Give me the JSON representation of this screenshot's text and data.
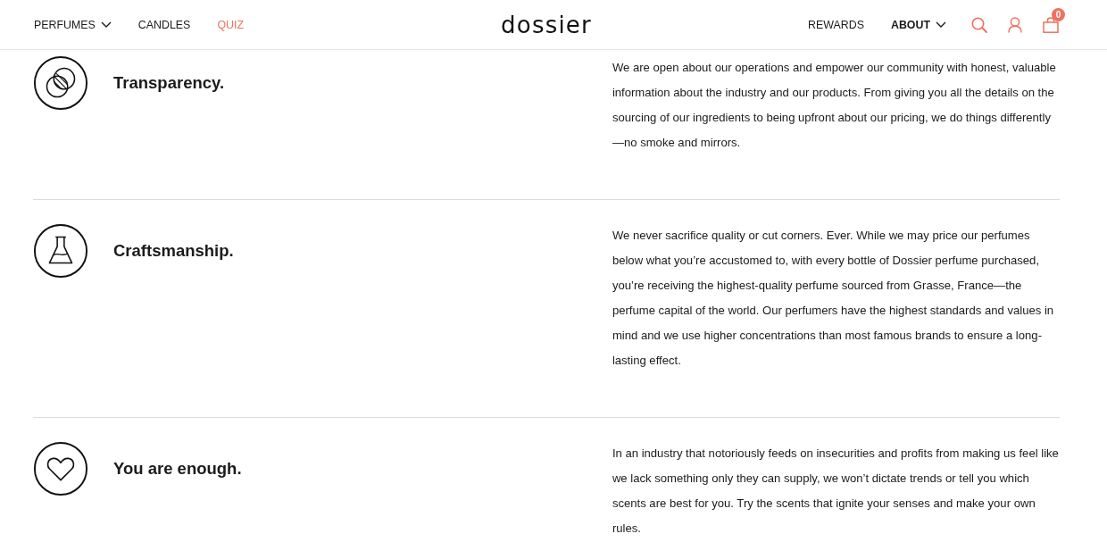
{
  "header": {
    "nav_left": [
      {
        "label": "PERFUMES",
        "dropdown": true,
        "highlighted": false,
        "selected": false
      },
      {
        "label": "CANDLES",
        "dropdown": false,
        "highlighted": false,
        "selected": false
      },
      {
        "label": "QUIZ",
        "dropdown": false,
        "highlighted": true,
        "selected": false
      }
    ],
    "logo": "dossier",
    "nav_right": [
      {
        "label": "REWARDS",
        "dropdown": false,
        "highlighted": false,
        "selected": false
      },
      {
        "label": "ABOUT",
        "dropdown": true,
        "highlighted": false,
        "selected": true
      }
    ],
    "icons": [
      {
        "kind": "search"
      },
      {
        "kind": "account"
      },
      {
        "kind": "bag",
        "badge": "0"
      }
    ]
  },
  "values": [
    {
      "kind": "circles",
      "title": "Transparency.",
      "text": "We are open about our operations and empower our community with honest, valuable information about the industry and our products. From giving you all the details on the sourcing of our ingredients to being upfront about our pricing, we do things differently—no smoke and mirrors."
    },
    {
      "kind": "flask",
      "title": "Craftsmanship.",
      "text": "We never sacrifice quality or cut corners. Ever. While we may price our perfumes below what you’re accustomed to, with every bottle of Dossier perfume purchased, you’re receiving the highest-quality perfume sourced from Grasse, France—the perfume capital of the world. Our perfumers have the highest standards and values in mind and we use higher concentrations than most famous brands to ensure a long-lasting effect."
    },
    {
      "kind": "heart",
      "title": "You are enough.",
      "text": "In an industry that notoriously feeds on insecurities and profits from making us feel like we lack something only they can supply, we won’t dictate trends or tell you which scents are best for you. Try the scents that ignite your senses and make your own rules."
    }
  ]
}
